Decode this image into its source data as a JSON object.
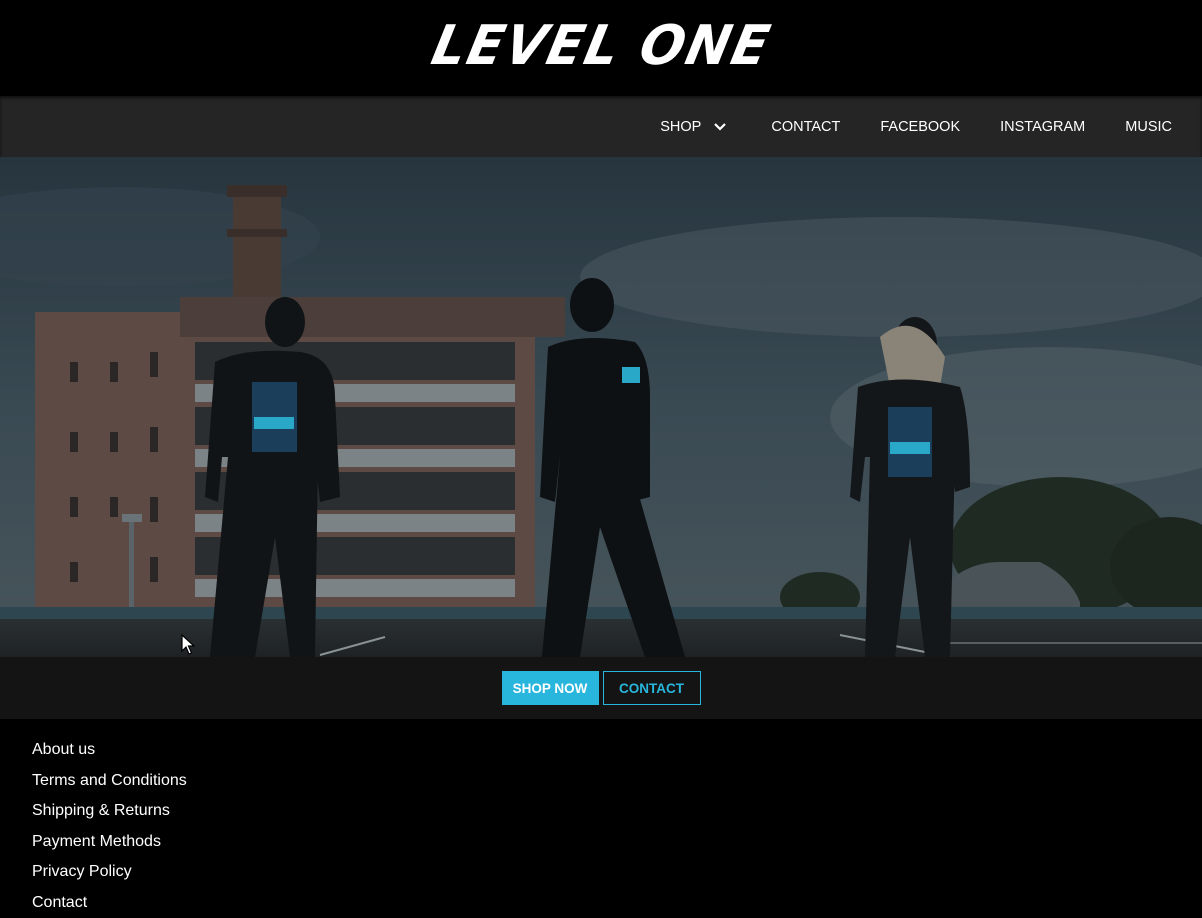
{
  "header": {
    "logo_text": "LEVEL ONE"
  },
  "nav": {
    "items": [
      {
        "label": "SHOP",
        "has_dropdown": true
      },
      {
        "label": "CONTACT"
      },
      {
        "label": "FACEBOOK"
      },
      {
        "label": "INSTAGRAM"
      },
      {
        "label": "MUSIC"
      }
    ]
  },
  "cta": {
    "shop_now_label": "SHOP NOW",
    "contact_label": "CONTACT",
    "accent_color": "#29b6dd"
  },
  "footer": {
    "links": [
      "About us",
      "Terms and Conditions",
      "Shipping & Returns",
      "Payment Methods",
      "Privacy Policy",
      "Contact"
    ]
  }
}
